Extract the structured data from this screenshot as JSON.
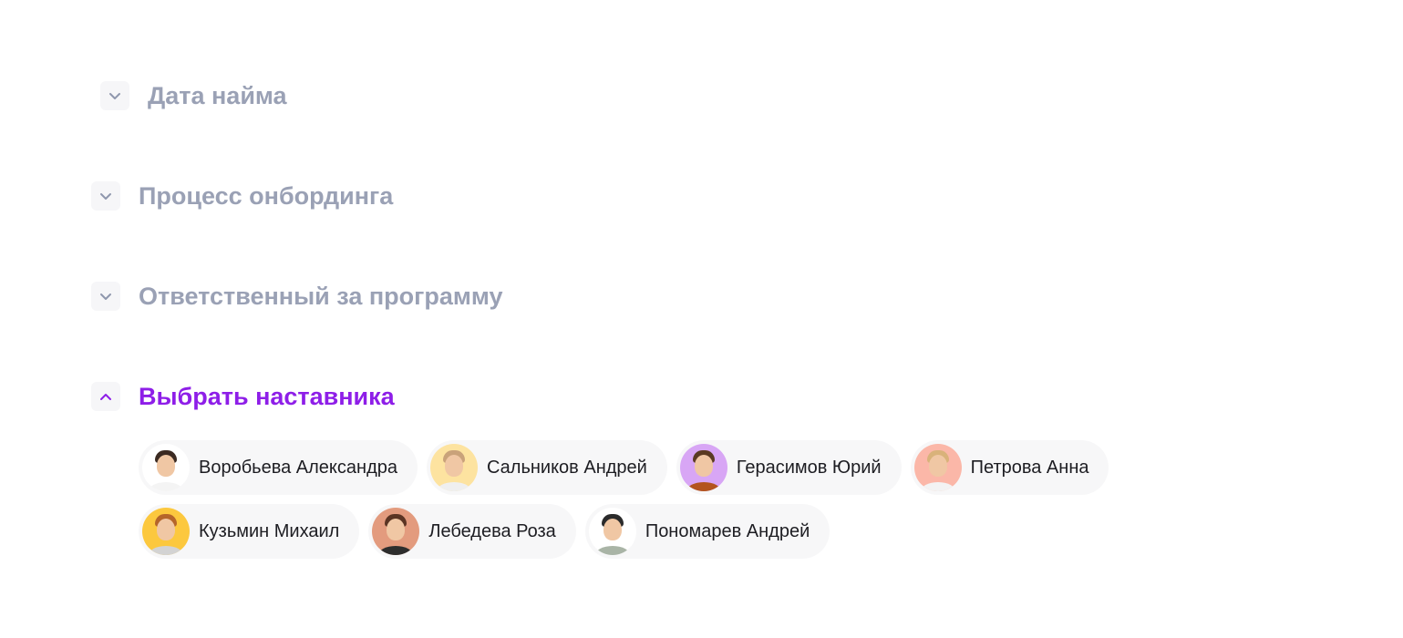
{
  "sections": [
    {
      "title": "Дата найма",
      "expanded": false
    },
    {
      "title": "Процесс онбординга",
      "expanded": false
    },
    {
      "title": "Ответственный за программу",
      "expanded": false
    },
    {
      "title": "Выбрать наставника",
      "expanded": true
    }
  ],
  "mentors": [
    {
      "name": "Воробьева Александра",
      "avatar_icon": "avatar-woman-dark-hair",
      "avatar_bg": "#ffffff",
      "hair": "#3b2a22",
      "body": "#f4f4f4"
    },
    {
      "name": "Сальников Андрей",
      "avatar_icon": "avatar-man-glasses",
      "avatar_bg": "#fde3a0",
      "hair": "#c9a27a",
      "body": "#efefef"
    },
    {
      "name": "Герасимов Юрий",
      "avatar_icon": "avatar-man-curly-hair",
      "avatar_bg": "#d8a6f5",
      "hair": "#5a3a22",
      "body": "#b3541e"
    },
    {
      "name": "Петрова Анна",
      "avatar_icon": "avatar-woman-blonde",
      "avatar_bg": "#fbb7a8",
      "hair": "#d9b27a",
      "body": "#f3f3f3"
    },
    {
      "name": "Кузьмин Михаил",
      "avatar_icon": "avatar-man-red-hair",
      "avatar_bg": "#fcc83e",
      "hair": "#b5652a",
      "body": "#d3d3d3"
    },
    {
      "name": "Лебедева Роза",
      "avatar_icon": "avatar-woman-brown-hair",
      "avatar_bg": "#e39b7e",
      "hair": "#5b3423",
      "body": "#2d2d2d"
    },
    {
      "name": "Пономарев Андрей",
      "avatar_icon": "avatar-man-shirt",
      "avatar_bg": "#ffffff",
      "hair": "#2b2b2b",
      "body": "#a9b4a6"
    }
  ],
  "colors": {
    "inactive_title": "#9aa1b5",
    "active_title": "#8e1ee8",
    "toggle_bg": "#f6f6f8",
    "chip_bg": "#f7f7f8"
  }
}
